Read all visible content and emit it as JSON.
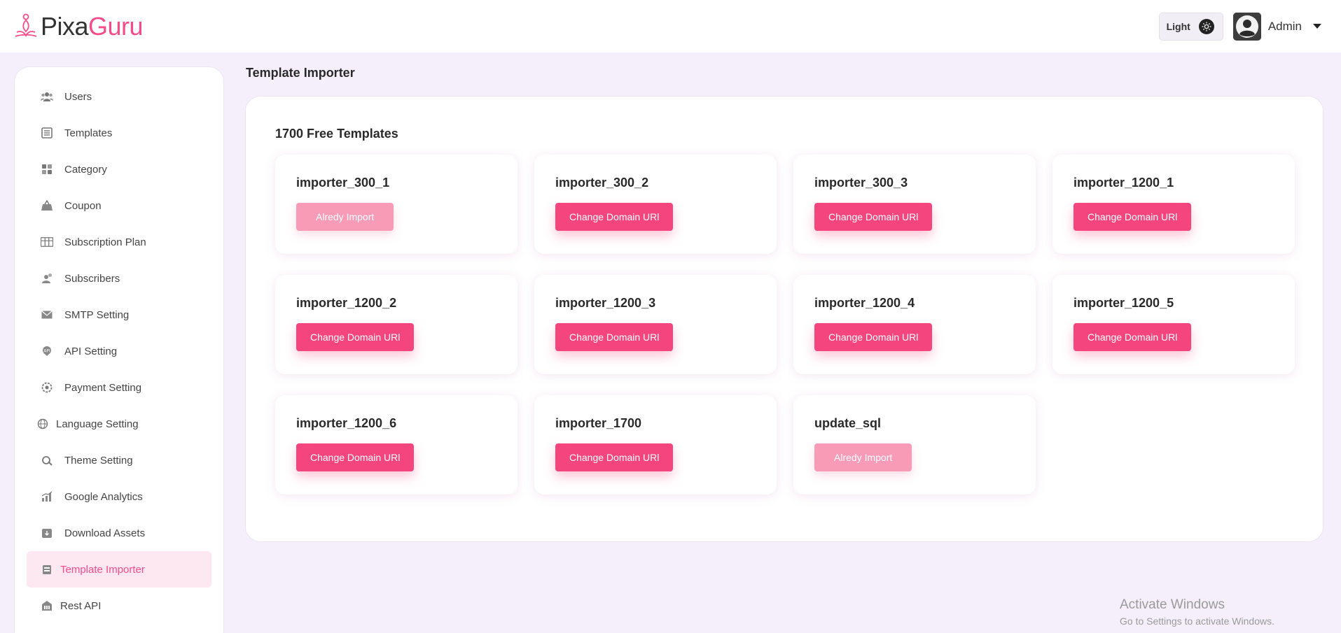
{
  "brand": {
    "part1": "Pixa",
    "part2": "Guru"
  },
  "header": {
    "theme_label": "Light",
    "user_name": "Admin"
  },
  "sidebar": {
    "items": [
      {
        "label": "Users",
        "icon": "users-icon"
      },
      {
        "label": "Templates",
        "icon": "templates-icon"
      },
      {
        "label": "Category",
        "icon": "category-icon"
      },
      {
        "label": "Coupon",
        "icon": "coupon-icon"
      },
      {
        "label": "Subscription Plan",
        "icon": "subscription-icon"
      },
      {
        "label": "Subscribers",
        "icon": "subscribers-icon"
      },
      {
        "label": "SMTP Setting",
        "icon": "mail-icon"
      },
      {
        "label": "API Setting",
        "icon": "api-icon"
      },
      {
        "label": "Payment Setting",
        "icon": "payment-icon"
      },
      {
        "label": "Language Setting",
        "icon": "language-icon"
      },
      {
        "label": "Theme Setting",
        "icon": "theme-icon"
      },
      {
        "label": "Google Analytics",
        "icon": "analytics-icon"
      },
      {
        "label": "Download Assets",
        "icon": "download-icon"
      },
      {
        "label": "Template Importer",
        "icon": "importer-icon",
        "active": true
      },
      {
        "label": "Rest API",
        "icon": "rest-api-icon"
      }
    ]
  },
  "main": {
    "page_title": "Template Importer",
    "panel_heading": "1700 Free Templates",
    "cards": [
      {
        "title": "importer_300_1",
        "button": "Alredy Import",
        "imported": true
      },
      {
        "title": "importer_300_2",
        "button": "Change Domain URl",
        "imported": false
      },
      {
        "title": "importer_300_3",
        "button": "Change Domain URl",
        "imported": false
      },
      {
        "title": "importer_1200_1",
        "button": "Change Domain URl",
        "imported": false
      },
      {
        "title": "importer_1200_2",
        "button": "Change Domain URl",
        "imported": false
      },
      {
        "title": "importer_1200_3",
        "button": "Change Domain URl",
        "imported": false
      },
      {
        "title": "importer_1200_4",
        "button": "Change Domain URl",
        "imported": false
      },
      {
        "title": "importer_1200_5",
        "button": "Change Domain URl",
        "imported": false
      },
      {
        "title": "importer_1200_6",
        "button": "Change Domain URl",
        "imported": false
      },
      {
        "title": "importer_1700",
        "button": "Change Domain URl",
        "imported": false
      },
      {
        "title": "update_sql",
        "button": "Alredy Import",
        "imported": true
      }
    ]
  },
  "watermark": {
    "title": "Activate Windows",
    "subtitle": "Go to Settings to activate Windows."
  },
  "colors": {
    "accent": "#f5457f",
    "accent_muted": "#f89bb7",
    "active_bg": "#fde7f0",
    "page_bg": "#f4effa"
  }
}
